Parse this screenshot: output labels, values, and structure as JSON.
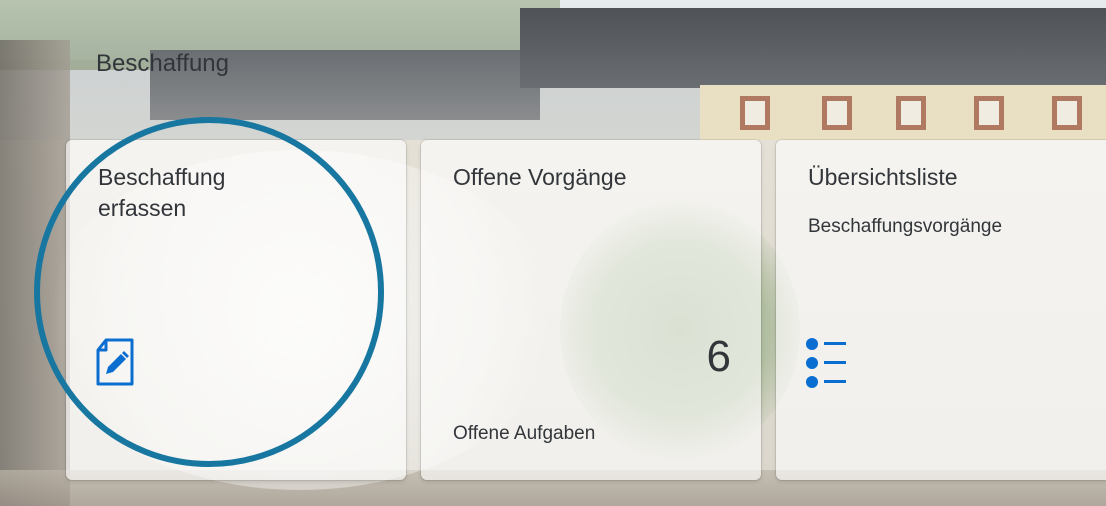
{
  "group": {
    "title": "Beschaffung"
  },
  "tiles": [
    {
      "title": "Beschaffung\nerfassen",
      "icon": "edit-document-icon"
    },
    {
      "title": "Offene Vorgänge",
      "kpi": "6",
      "footer": "Offene Aufgaben"
    },
    {
      "title": "Übersichtsliste",
      "subtitle": "Beschaffungsvorgänge",
      "icon": "bulleted-list-icon"
    }
  ],
  "colors": {
    "text": "#32363a",
    "icon": "#0a6ed1",
    "highlight_ring": "#1877a0",
    "tile_background": "rgba(255,255,255,0.62)"
  }
}
